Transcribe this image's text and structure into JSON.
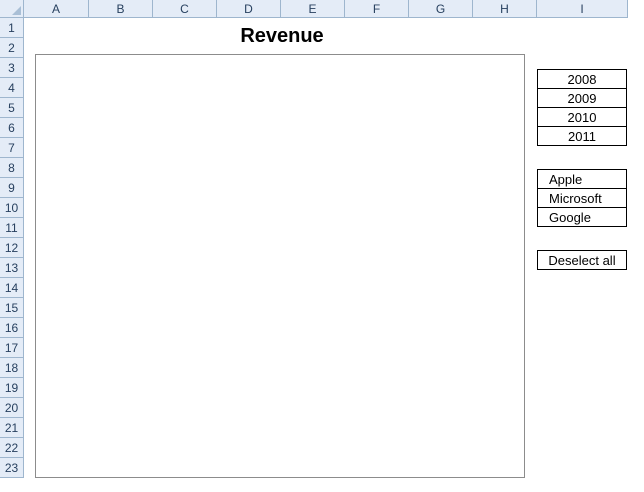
{
  "title": "Revenue",
  "columns": [
    "A",
    "B",
    "C",
    "D",
    "E",
    "F",
    "G",
    "H",
    "I"
  ],
  "rows": [
    "1",
    "2",
    "3",
    "4",
    "5",
    "6",
    "7",
    "8",
    "9",
    "10",
    "11",
    "12",
    "13",
    "14",
    "15",
    "16",
    "17",
    "18",
    "19",
    "20",
    "21",
    "22",
    "23"
  ],
  "year_buttons": [
    "2008",
    "2009",
    "2010",
    "2011"
  ],
  "company_buttons": [
    "Apple",
    "Microsoft",
    "Google"
  ],
  "deselect_label": "Deselect all"
}
